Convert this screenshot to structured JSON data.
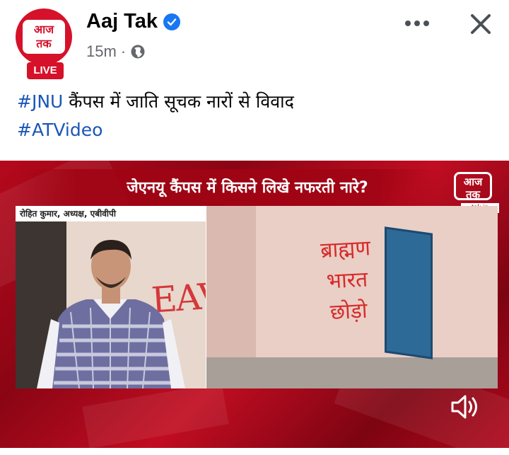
{
  "post": {
    "page_name": "Aaj Tak",
    "time_ago": "15m",
    "separator": "·",
    "avatar": {
      "logo_line1": "आज",
      "logo_line2": "तक",
      "live_label": "LIVE"
    },
    "caption": {
      "hashtag1": "#JNU",
      "line1_text": " कैंपस में जाति सूचक नारों से विवाद",
      "hashtag2": "#ATVideo"
    }
  },
  "video": {
    "headline": "जेएनयू कैंपस में किसने लिखे नफरती नारे?",
    "channel_logo_line1": "आज",
    "channel_logo_line2": "तक",
    "channel_url": "tak.in",
    "speaker_strap": "रोहित कुमार, अध्यक्ष, एबीवीपी",
    "graffiti_left": "EAVE",
    "graffiti_right_line1": "ब्राह्मण",
    "graffiti_right_line2": "भारत",
    "graffiti_right_line3": "छोड़ो"
  },
  "icons": {
    "verified": "verified-badge-icon",
    "globe": "globe-icon",
    "more": "more-options-icon",
    "close": "close-icon",
    "mute": "speaker-icon"
  },
  "colors": {
    "accent_red": "#d6112a",
    "hashtag_blue": "#1a56b8",
    "verified_blue": "#1877f2",
    "meta_gray": "#65676b"
  }
}
